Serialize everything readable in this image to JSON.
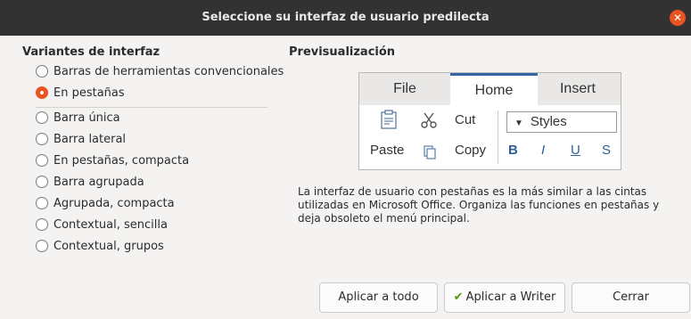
{
  "window": {
    "title": "Seleccione su interfaz de usuario predilecta",
    "close_glyph": "✕"
  },
  "variants": {
    "heading": "Variantes de interfaz",
    "selected_index": 1,
    "options": [
      "Barras de herramientas convencionales",
      "En pestañas",
      "Barra única",
      "Barra lateral",
      "En pestañas, compacta",
      "Barra agrupada",
      "Agrupada, compacta",
      "Contextual, sencilla",
      "Contextual, grupos"
    ]
  },
  "preview": {
    "heading": "Previsualización",
    "tabs": [
      "File",
      "Home",
      "Insert"
    ],
    "active_tab": "Home",
    "paste": "Paste",
    "cut": "Cut",
    "copy": "Copy",
    "styles": "Styles",
    "format": {
      "bold": "B",
      "italic": "I",
      "underline": "U",
      "strike": "S"
    },
    "icons": [
      "clipboard-icon",
      "scissors-icon",
      "copy-icon",
      "dropdown-arrow-icon"
    ]
  },
  "description": "La interfaz de usuario con pestañas es la más similar a las cintas utilizadas en Microsoft Office. Organiza las funciones en pestañas y deja obsoleto el menú principal.",
  "buttons": {
    "apply_all": "Aplicar a todo",
    "apply_writer": "Aplicar a Writer",
    "close": "Cerrar"
  },
  "colors": {
    "accent": "#e95420",
    "titlebar": "#323232",
    "check": "#4e9a06",
    "tab_highlight": "#3465a4"
  }
}
